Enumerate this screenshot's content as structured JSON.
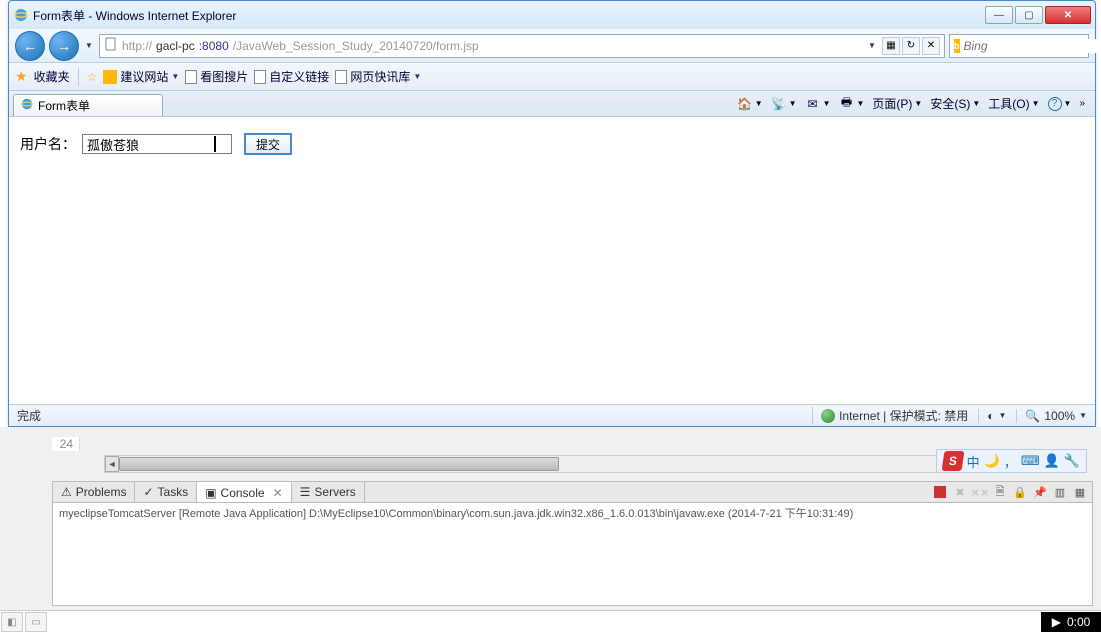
{
  "window": {
    "title": "Form表单 - Windows Internet Explorer"
  },
  "address": {
    "prefix": "http://",
    "host": "gacl-pc",
    "port": ":8080",
    "path": "/JavaWeb_Session_Study_20140720/form.jsp"
  },
  "search": {
    "placeholder": "Bing"
  },
  "favbar": {
    "label": "收藏夹",
    "links": [
      "建议网站",
      "看图搜片",
      "自定义链接",
      "网页快讯库"
    ]
  },
  "tab": {
    "title": "Form表单"
  },
  "toolbar": {
    "page": "页面(P)",
    "safety": "安全(S)",
    "tools": "工具(O)"
  },
  "form": {
    "label": "用户名：",
    "value": "孤傲苍狼",
    "submit": "提交"
  },
  "status": {
    "left": "完成",
    "zone": "Internet | 保护模式: 禁用",
    "zoom": "100%"
  },
  "editor": {
    "lineno": "24"
  },
  "views": {
    "problems": "Problems",
    "tasks": "Tasks",
    "console": "Console",
    "servers": "Servers"
  },
  "console": {
    "header": "myeclipseTomcatServer [Remote Java Application] D:\\MyEclipse10\\Common\\binary\\com.sun.java.jdk.win32.x86_1.6.0.013\\bin\\javaw.exe (2014-7-21 下午10:31:49)"
  },
  "ime": {
    "lang": "中"
  },
  "clock": "0:00"
}
